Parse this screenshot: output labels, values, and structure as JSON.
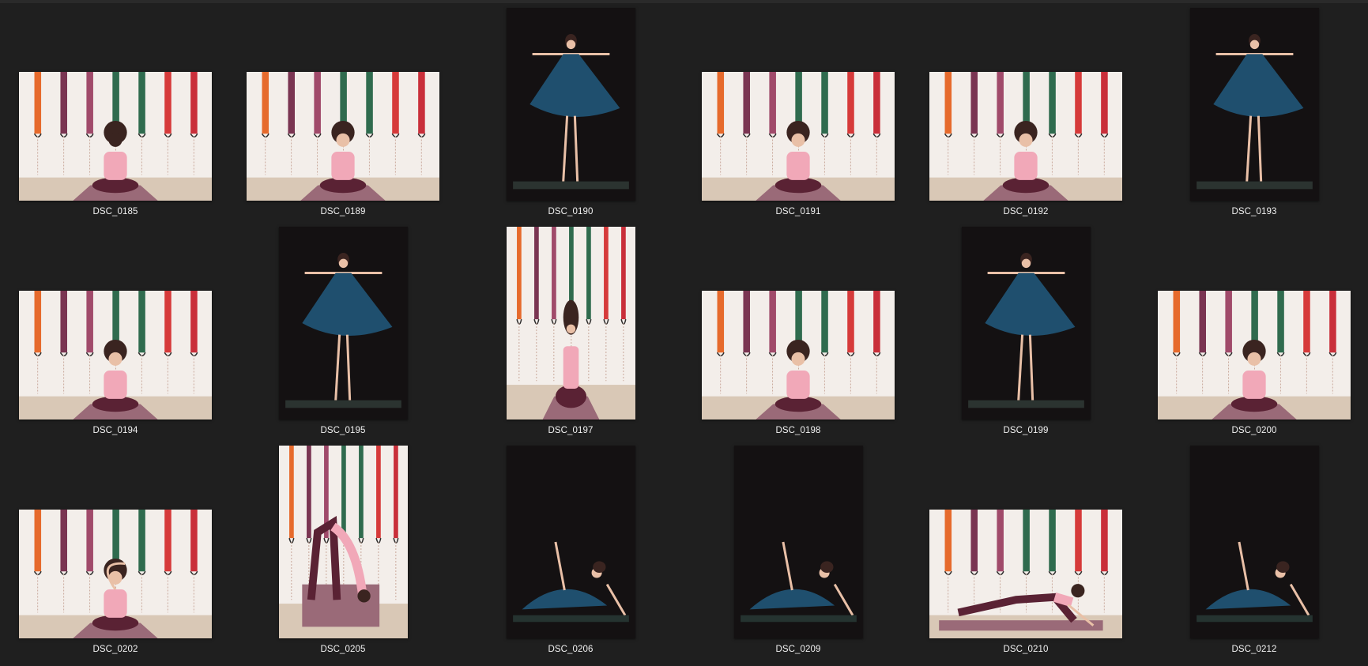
{
  "gallery": {
    "items": [
      {
        "label": "DSC_0185",
        "scene": "light",
        "subject": "seated-back"
      },
      {
        "label": "DSC_0189",
        "scene": "light",
        "subject": "seated-front"
      },
      {
        "label": "DSC_0190",
        "scene": "dark",
        "subject": "dress-spin"
      },
      {
        "label": "DSC_0191",
        "scene": "light",
        "subject": "seated-front"
      },
      {
        "label": "DSC_0192",
        "scene": "light",
        "subject": "seated-front"
      },
      {
        "label": "DSC_0193",
        "scene": "dark",
        "subject": "dress-spin"
      },
      {
        "label": "DSC_0194",
        "scene": "light",
        "subject": "seated-front"
      },
      {
        "label": "DSC_0195",
        "scene": "dark",
        "subject": "dress-spin"
      },
      {
        "label": "DSC_0197",
        "scene": "light",
        "subject": "seated-front"
      },
      {
        "label": "DSC_0198",
        "scene": "light",
        "subject": "seated-front"
      },
      {
        "label": "DSC_0199",
        "scene": "dark",
        "subject": "dress-spin"
      },
      {
        "label": "DSC_0200",
        "scene": "light",
        "subject": "seated-front"
      },
      {
        "label": "DSC_0202",
        "scene": "light",
        "subject": "stretch"
      },
      {
        "label": "DSC_0205",
        "scene": "light",
        "subject": "forward-fold"
      },
      {
        "label": "DSC_0206",
        "scene": "dark",
        "subject": "reclining"
      },
      {
        "label": "DSC_0209",
        "scene": "dark",
        "subject": "leg-raise"
      },
      {
        "label": "DSC_0210",
        "scene": "light",
        "subject": "lunge"
      },
      {
        "label": "DSC_0212",
        "scene": "dark",
        "subject": "leg-raise"
      }
    ]
  },
  "colors": {
    "background": "#1f1f1f",
    "caption": "#f2f2f2",
    "wall": "#f3eeea",
    "floor": "#d9c8b6",
    "mat": "#9a6a78",
    "dark_bg": "#141112",
    "dress": "#1f4f6e",
    "top": "#f1a8b8",
    "leggings": "#5a2234",
    "skin": "#e9c0a7",
    "hair": "#3a2420"
  }
}
